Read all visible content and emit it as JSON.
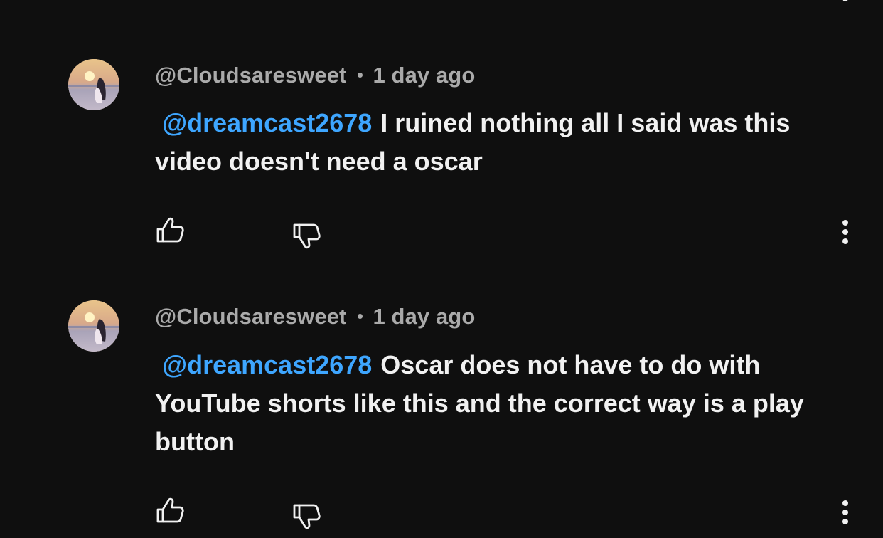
{
  "comments": [
    {
      "author": "@Cloudsaresweet",
      "time": "1 day ago",
      "mention": "@dreamcast2678",
      "text": "I ruined nothing all I said was this video doesn't need a oscar"
    },
    {
      "author": "@Cloudsaresweet",
      "time": "1 day ago",
      "mention": "@dreamcast2678",
      "text": "Oscar does not have to do with YouTube shorts like this and the correct way is a play button"
    }
  ],
  "icons": {
    "like": "thumb-up-icon",
    "dislike": "thumb-down-icon",
    "more": "more-vertical-icon"
  },
  "colors": {
    "background": "#0f0f0f",
    "text": "#f1f1f1",
    "meta": "#aaaaaa",
    "mention": "#3ea6ff"
  }
}
